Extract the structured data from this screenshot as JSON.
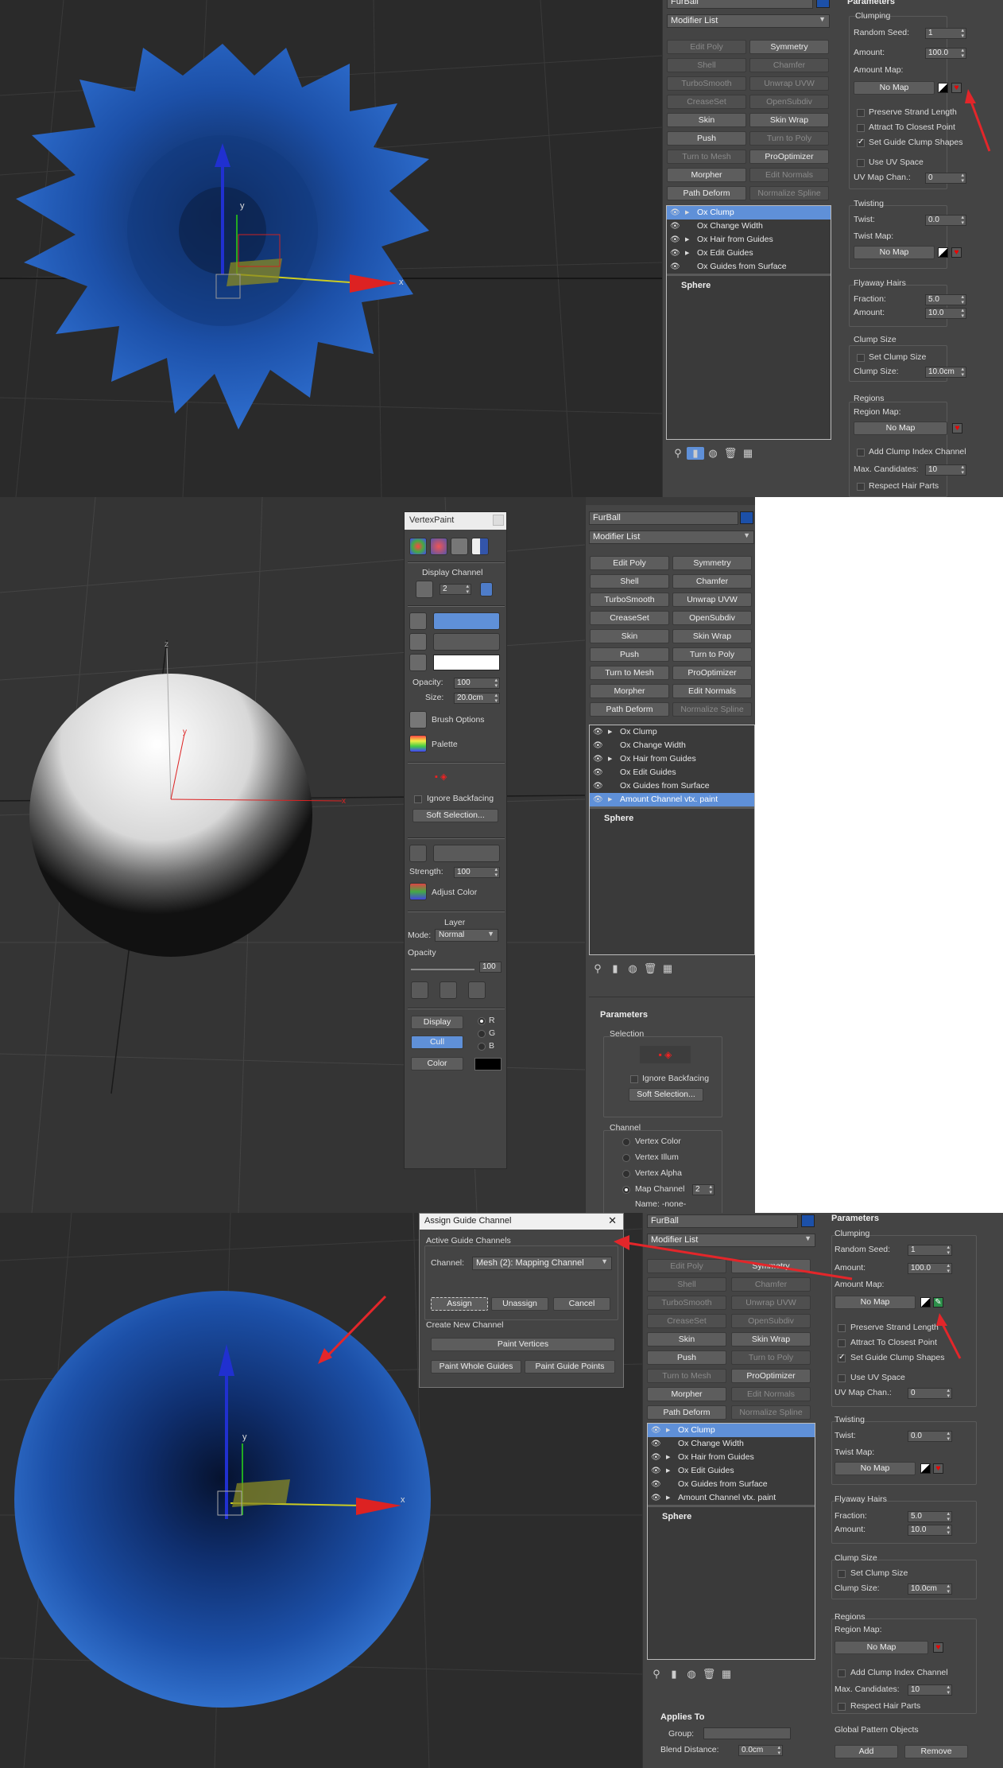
{
  "colors": {
    "accent": "#5f90d8",
    "fur": "#1c50a8",
    "arrow": "#e3262a",
    "gizmo_x": "#d22",
    "gizmo_y": "#2a2",
    "gizmo_z": "#22c"
  },
  "panel1": {
    "object_name": "FurBall",
    "modifier_list": "Modifier List",
    "buttons": [
      [
        "Edit Poly",
        "Symmetry"
      ],
      [
        "Shell",
        "Chamfer"
      ],
      [
        "TurboSmooth",
        "Unwrap UVW"
      ],
      [
        "CreaseSet",
        "OpenSubdiv"
      ],
      [
        "Skin",
        "Skin Wrap"
      ],
      [
        "Push",
        "Turn to Poly"
      ],
      [
        "Turn to Mesh",
        "ProOptimizer"
      ],
      [
        "Morpher",
        "Edit Normals"
      ],
      [
        "Path Deform",
        "Normalize Spline"
      ]
    ],
    "disabled": [
      "Edit Poly",
      "Shell",
      "Chamfer",
      "TurboSmooth",
      "Unwrap UVW",
      "CreaseSet",
      "OpenSubdiv",
      "Turn to Poly",
      "Turn to Mesh",
      "Edit Normals",
      "Normalize Spline"
    ],
    "stack": [
      "Ox Clump",
      "Ox Change Width",
      "Ox Hair from Guides",
      "Ox Edit Guides",
      "Ox Guides from Surface"
    ],
    "stack_base": "Sphere"
  },
  "params1": {
    "title": "Parameters",
    "clumping": "Clumping",
    "random_seed_label": "Random Seed:",
    "random_seed": "1",
    "amount_label": "Amount:",
    "amount": "100.0",
    "amount_map_label": "Amount Map:",
    "no_map": "No Map",
    "preserve": "Preserve Strand Length",
    "attract": "Attract To Closest Point",
    "set_guide": "Set Guide Clump Shapes",
    "use_uv": "Use UV Space",
    "uv_chan_label": "UV Map Chan.:",
    "uv_chan": "0",
    "twisting": "Twisting",
    "twist_label": "Twist:",
    "twist": "0.0",
    "twist_map_label": "Twist Map:",
    "flyaway": "Flyaway Hairs",
    "fraction_label": "Fraction:",
    "fraction": "5.0",
    "fly_amount": "10.0",
    "clump_size": "Clump Size",
    "set_clump_size": "Set Clump Size",
    "clump_size_label": "Clump Size:",
    "clump_size_val": "10.0cm",
    "regions": "Regions",
    "region_map_label": "Region Map:",
    "add_clump_index": "Add Clump Index Channel",
    "max_cand_label": "Max. Candidates:",
    "max_cand": "10",
    "respect": "Respect Hair Parts"
  },
  "vertexpaint": {
    "title": "VertexPaint",
    "display_channel": "Display Channel",
    "channel_val": "2",
    "opacity_label": "Opacity:",
    "opacity": "100",
    "size_label": "Size:",
    "size": "20.0cm",
    "brush_options": "Brush Options",
    "palette": "Palette",
    "ignore_backfacing": "Ignore Backfacing",
    "soft_selection": "Soft Selection...",
    "strength_label": "Strength:",
    "strength": "100",
    "adjust_color": "Adjust Color",
    "layer": "Layer",
    "mode_label": "Mode:",
    "mode": "Normal",
    "opacity2_label": "Opacity",
    "opacity2": "100",
    "display_btn": "Display",
    "cull_btn": "Cull",
    "color_btn": "Color",
    "r": "R",
    "g": "G",
    "b": "B"
  },
  "panel2": {
    "object_name": "FurBall",
    "modifier_list": "Modifier List",
    "stack": [
      "Ox Clump",
      "Ox Change Width",
      "Ox Hair from Guides",
      "Ox Edit Guides",
      "Ox Guides from Surface",
      "Amount Channel vtx. paint"
    ],
    "stack_base": "Sphere",
    "params_title": "Parameters",
    "selection": "Selection",
    "ignore_backfacing": "Ignore Backfacing",
    "soft_selection": "Soft Selection...",
    "channel": "Channel",
    "vertex_color": "Vertex Color",
    "vertex_illum": "Vertex Illum",
    "vertex_alpha": "Vertex Alpha",
    "map_channel": "Map Channel",
    "map_channel_val": "2",
    "name_label": "Name: -none-"
  },
  "dialog": {
    "title": "Assign Guide Channel",
    "close": "✕",
    "active": "Active Guide Channels",
    "channel_label": "Channel:",
    "channel_val": "Mesh (2): Mapping Channel",
    "assign": "Assign",
    "unassign": "Unassign",
    "cancel": "Cancel",
    "create_new": "Create New Channel",
    "paint_vertices": "Paint Vertices",
    "paint_whole": "Paint Whole Guides",
    "paint_points": "Paint Guide Points"
  },
  "panel3": {
    "object_name": "FurBall",
    "modifier_list": "Modifier List",
    "stack": [
      "Ox Clump",
      "Ox Change Width",
      "Ox Hair from Guides",
      "Ox Edit Guides",
      "Ox Guides from Surface",
      "Amount Channel vtx. paint"
    ],
    "stack_base": "Sphere",
    "applies_to": "Applies To",
    "group_label": "Group:",
    "blend_label": "Blend Distance:",
    "blend": "0.0cm",
    "global_pattern": "Global Pattern Objects",
    "add": "Add",
    "remove": "Remove"
  },
  "axis": {
    "x": "x",
    "y": "y",
    "z": "z"
  }
}
